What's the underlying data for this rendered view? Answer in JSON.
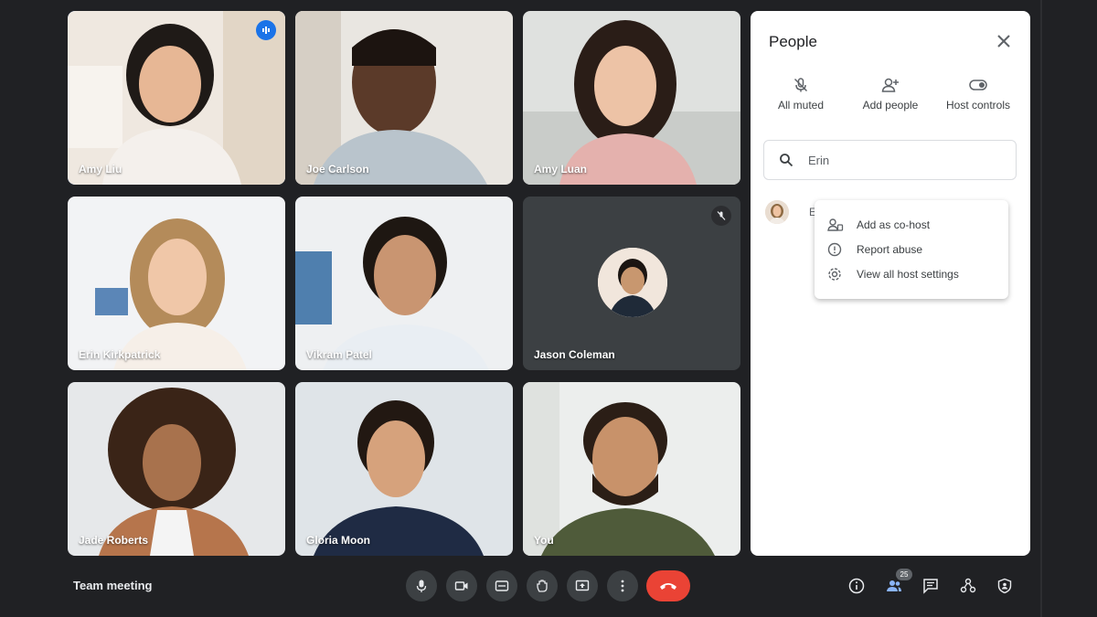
{
  "participants": [
    {
      "name": "Amy Liu"
    },
    {
      "name": "Joe Carlson"
    },
    {
      "name": "Amy Luan"
    },
    {
      "name": "Erin Kirkpatrick"
    },
    {
      "name": "Vikram Patel"
    },
    {
      "name": "Jason Coleman"
    },
    {
      "name": "Jade Roberts"
    },
    {
      "name": "Gloria Moon"
    },
    {
      "name": "You"
    }
  ],
  "people_panel": {
    "title": "People",
    "actions": [
      {
        "label": "All muted",
        "icon": "mic-off-icon"
      },
      {
        "label": "Add people",
        "icon": "add-person-icon"
      },
      {
        "label": "Host controls",
        "icon": "toggle-icon"
      }
    ],
    "search_value": "Erin",
    "result_initial": "E"
  },
  "context_menu": {
    "items": [
      {
        "label": "Add as co-host",
        "icon": "cohost-icon"
      },
      {
        "label": "Report abuse",
        "icon": "report-icon"
      },
      {
        "label": "View all host settings",
        "icon": "settings-icon"
      }
    ]
  },
  "bottom_bar": {
    "meeting_title": "Team meeting",
    "people_count": "25"
  },
  "colors": {
    "background": "#202124",
    "accent": "#1a73e8",
    "end_call": "#ea4335"
  }
}
